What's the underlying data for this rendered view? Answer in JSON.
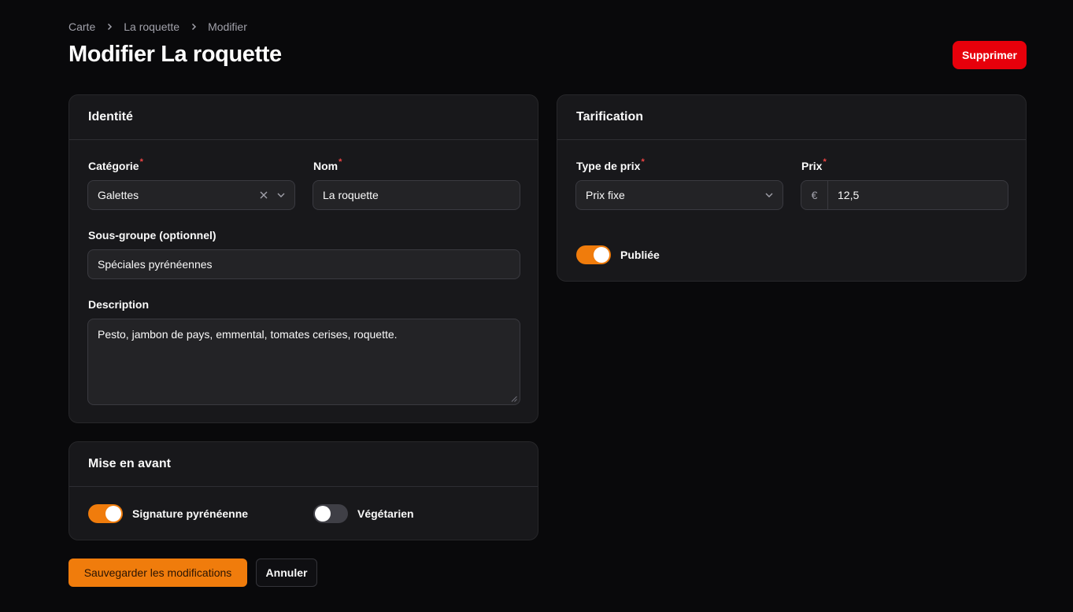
{
  "breadcrumb": [
    {
      "label": "Carte"
    },
    {
      "label": "La roquette"
    },
    {
      "label": "Modifier"
    }
  ],
  "page": {
    "title": "Modifier La roquette",
    "delete_label": "Supprimer"
  },
  "identite": {
    "title": "Identité",
    "categorie_label": "Catégorie",
    "categorie_value": "Galettes",
    "nom_label": "Nom",
    "nom_value": "La roquette",
    "sousgroupe_label": "Sous-groupe (optionnel)",
    "sousgroupe_value": "Spéciales pyrénéennes",
    "description_label": "Description",
    "description_value": "Pesto, jambon de pays, emmental, tomates cerises, roquette."
  },
  "tarification": {
    "title": "Tarification",
    "type_label": "Type de prix",
    "type_value": "Prix fixe",
    "prix_label": "Prix",
    "currency_symbol": "€",
    "prix_value": "12,5",
    "publiee_label": "Publiée",
    "publiee_on": true
  },
  "mise_en_avant": {
    "title": "Mise en avant",
    "signature_label": "Signature pyrénéenne",
    "signature_on": true,
    "vegetarien_label": "Végétarien",
    "vegetarien_on": false
  },
  "required_marker": "*",
  "actions": {
    "save_label": "Sauvegarder les modifications",
    "cancel_label": "Annuler"
  },
  "colors": {
    "background": "#09090b",
    "card": "#18181b",
    "accent": "#f07c0c",
    "danger": "#e7000b"
  }
}
